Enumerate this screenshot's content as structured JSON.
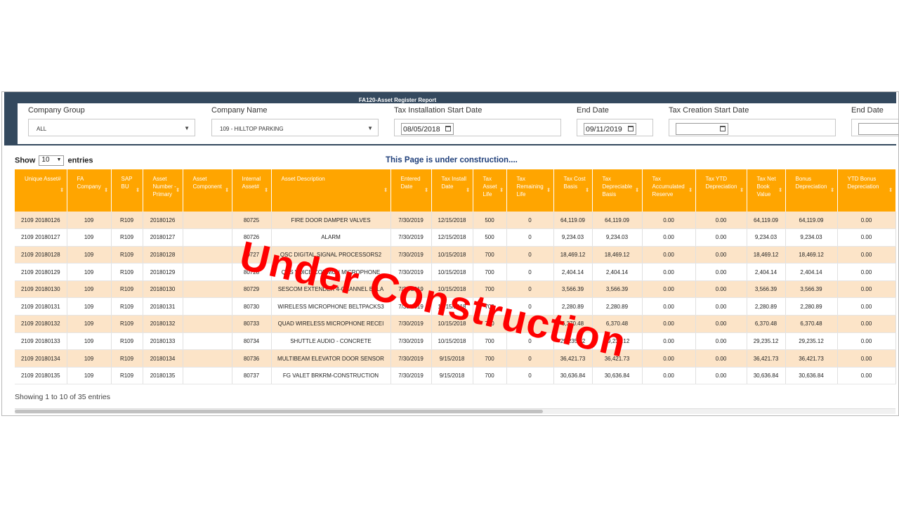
{
  "report": {
    "title": "FA120-Asset Register Report"
  },
  "filters": {
    "company_group": {
      "label": "Company Group",
      "value": "ALL"
    },
    "company_name": {
      "label": "Company Name",
      "value": "109 - HILLTOP PARKING"
    },
    "tax_install_start": {
      "label": "Tax Installation Start Date",
      "value": "08/05/2018"
    },
    "end_date_1": {
      "label": "End Date",
      "value": "09/11/2019"
    },
    "tax_creation_start": {
      "label": "Tax Creation Start Date",
      "value": ""
    },
    "end_date_2": {
      "label": "End Date",
      "value": ""
    }
  },
  "length_menu": {
    "prefix": "Show",
    "value": "10",
    "suffix": "entries"
  },
  "notice": "This Page is under construction....",
  "table": {
    "headers": [
      "Unique Asset#",
      "FA Company",
      "SAP BU",
      "Asset Number - Primary",
      "Asset Component",
      "Internal Asset#",
      "Asset Description",
      "Entered Date",
      "Tax Install Date",
      "Tax Asset Life",
      "Tax Remaining Life",
      "Tax Cost Basis",
      "Tax Depreciable Basis",
      "Tax Accumulated Reserve",
      "Tax YTD Depreciation",
      "Tax Net Book Value",
      "Bonus Depreciation",
      "YTD Bonus Depreciation"
    ],
    "rows": [
      [
        "2109 20180126",
        "109",
        "R109",
        "20180126",
        "",
        "80725",
        "FIRE DOOR DAMPER VALVES",
        "7/30/2019",
        "12/15/2018",
        "500",
        "0",
        "64,119.09",
        "64,119.09",
        "0.00",
        "0.00",
        "64,119.09",
        "64,119.09",
        "0.00"
      ],
      [
        "2109 20180127",
        "109",
        "R109",
        "20180127",
        "",
        "80726",
        "ALARM",
        "7/30/2019",
        "12/15/2018",
        "500",
        "0",
        "9,234.03",
        "9,234.03",
        "0.00",
        "0.00",
        "9,234.03",
        "9,234.03",
        "0.00"
      ],
      [
        "2109 20180128",
        "109",
        "R109",
        "20180128",
        "",
        "80727",
        "QSC DIGITAL SIGNAL PROCESSORS2",
        "7/30/2019",
        "10/15/2018",
        "700",
        "0",
        "18,469.12",
        "18,469.12",
        "0.00",
        "0.00",
        "18,469.12",
        "18,469.12",
        "0.00"
      ],
      [
        "2109 20180129",
        "109",
        "R109",
        "20180129",
        "",
        "80728",
        "QYS VOICE COMMUN MICROPHONE",
        "7/30/2019",
        "10/15/2018",
        "700",
        "0",
        "2,404.14",
        "2,404.14",
        "0.00",
        "0.00",
        "2,404.14",
        "2,404.14",
        "0.00"
      ],
      [
        "2109 20180130",
        "109",
        "R109",
        "20180130",
        "",
        "80729",
        "SESCOM EXTENDER 4-CHANNEL BALA",
        "7/30/2019",
        "10/15/2018",
        "700",
        "0",
        "3,566.39",
        "3,566.39",
        "0.00",
        "0.00",
        "3,566.39",
        "3,566.39",
        "0.00"
      ],
      [
        "2109 20180131",
        "109",
        "R109",
        "20180131",
        "",
        "80730",
        "WIRELESS MICROPHONE BELTPACKS3",
        "7/30/2019",
        "10/15/2018",
        "700",
        "0",
        "2,280.89",
        "2,280.89",
        "0.00",
        "0.00",
        "2,280.89",
        "2,280.89",
        "0.00"
      ],
      [
        "2109 20180132",
        "109",
        "R109",
        "20180132",
        "",
        "80733",
        "QUAD WIRELESS MICROPHONE RECEI",
        "7/30/2019",
        "10/15/2018",
        "700",
        "0",
        "6,370.48",
        "6,370.48",
        "0.00",
        "0.00",
        "6,370.48",
        "6,370.48",
        "0.00"
      ],
      [
        "2109 20180133",
        "109",
        "R109",
        "20180133",
        "",
        "80734",
        "SHUTTLE AUDIO - CONCRETE",
        "7/30/2019",
        "10/15/2018",
        "700",
        "0",
        "29,235.12",
        "29,235.12",
        "0.00",
        "0.00",
        "29,235.12",
        "29,235.12",
        "0.00"
      ],
      [
        "2109 20180134",
        "109",
        "R109",
        "20180134",
        "",
        "80736",
        "MULTIBEAM ELEVATOR DOOR SENSOR",
        "7/30/2019",
        "9/15/2018",
        "700",
        "0",
        "36,421.73",
        "36,421.73",
        "0.00",
        "0.00",
        "36,421.73",
        "36,421.73",
        "0.00"
      ],
      [
        "2109 20180135",
        "109",
        "R109",
        "20180135",
        "",
        "80737",
        "FG VALET BRKRM-CONSTRUCTION",
        "7/30/2019",
        "9/15/2018",
        "700",
        "0",
        "30,636.84",
        "30,636.84",
        "0.00",
        "0.00",
        "30,636.84",
        "30,636.84",
        "0.00"
      ]
    ]
  },
  "footer": {
    "info": "Showing 1 to 10 of 35 entries"
  },
  "overlay": {
    "text": "Under Construction",
    "color": "#ff0000"
  },
  "colors": {
    "header_band": "#34495e",
    "table_header": "#ffa500",
    "odd_row": "#fce4c8",
    "notice": "#1f3f7a"
  }
}
